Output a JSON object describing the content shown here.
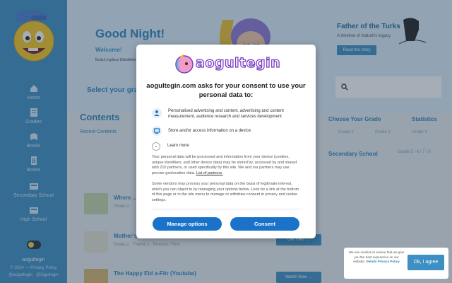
{
  "colors": {
    "accent": "#3d8fc4",
    "consent_button": "#1a73c9",
    "logo_purple": "#7a3fc5"
  },
  "sidebar": {
    "items": [
      {
        "label": "Home",
        "icon": "home-icon"
      },
      {
        "label": "Grades",
        "icon": "grades-icon"
      },
      {
        "label": "Books",
        "icon": "books-icon"
      },
      {
        "label": "Boxes",
        "icon": "boxes-icon"
      },
      {
        "label": "Secondary School",
        "icon": "secondary-school-icon"
      },
      {
        "label": "High School",
        "icon": "high-school-icon"
      }
    ],
    "brand": "aogultegin",
    "copyright": "© 2024 — Privacy Policy",
    "credits": "@aogultegin · @Ogultegin"
  },
  "hero": {
    "greeting": "Good Night!",
    "welcome": "Welcome!",
    "subtitle": "İlkokul İngilizce Etkinlikleri"
  },
  "feature": {
    "title": "Father of the Turks",
    "subtitle": "A timeline of Ataturk's legacy",
    "button": "Read the story"
  },
  "main": {
    "select_grade": "Select your grade",
    "contents": "Contents",
    "recent": "Recent Contents",
    "choose_grade": "Choose Your Grade",
    "statistics": "Statistics",
    "grades": [
      "Grade 2",
      "Grade 3",
      "Grade 4"
    ],
    "secondary_school": "Secondary School",
    "secondary_link": "Grade 5 / 6 / 7 / 8",
    "rows": [
      {
        "title": "Where ...",
        "meta": "Grade 2",
        "button": ""
      },
      {
        "title": "Mother's ...",
        "meta": "Grade 2 · Theme 1 · Revision Time",
        "button": "Get Files →"
      },
      {
        "title": "The Happy Eid a-Fitr (Youtube)",
        "meta": "",
        "button": "Watch Now →"
      }
    ]
  },
  "consent": {
    "logo": "aogultegin",
    "heading": "aogultegin.com asks for your consent to use your personal data to:",
    "purposes": [
      {
        "icon": "person-icon",
        "text": "Personalised advertising and content, advertising and content measurement, audience research and services development"
      },
      {
        "icon": "device-icon",
        "text": "Store and/or access information on a device"
      }
    ],
    "learn_more": "Learn more",
    "desc1_pre": "Your personal data will be processed and information from your device (cookies, unique identifiers, and other device data) may be stored by, accessed by and shared with 210 partners, or used specifically by this site. We and our partners may use precise geolocation data.",
    "desc1_link": "List of partners.",
    "desc2": "Some vendors may process your personal data on the basis of legitimate interest, which you can object to by managing your options below. Look for a link at the bottom of this page or in the site menu to manage or withdraw consent in privacy and cookie settings.",
    "manage_button": "Manage options",
    "consent_button": "Consent"
  },
  "cookie": {
    "text_pre": "We use cookies to ensure that we give you the best experience on our website.",
    "link": "Details Privacy Policy",
    "button": "Ok, I agree"
  }
}
